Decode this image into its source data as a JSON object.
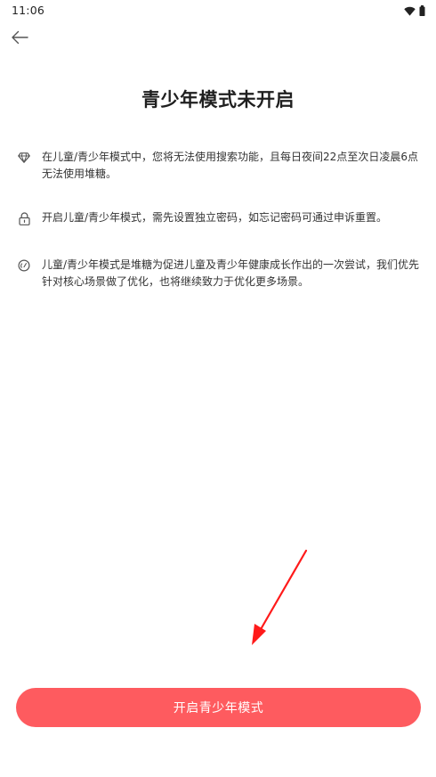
{
  "status_bar": {
    "time": "11:06",
    "icons": [
      "wifi-icon",
      "battery-icon"
    ]
  },
  "nav": {
    "back_icon": "arrow-left-icon"
  },
  "title": "青少年模式未开启",
  "info_items": [
    {
      "icon": "diamond-icon",
      "text": "在儿童/青少年模式中，您将无法使用搜索功能，且每日夜间22点至次日凌晨6点无法使用堆糖。"
    },
    {
      "icon": "lock-icon",
      "text": "开启儿童/青少年模式，需先设置独立密码，如忘记密码可通过申诉重置。"
    },
    {
      "icon": "gauge-icon",
      "text": "儿童/青少年模式是堆糖为促进儿童及青少年健康成长作出的一次尝试，我们优先针对核心场景做了优化，也将继续致力于优化更多场景。"
    }
  ],
  "primary_button": {
    "label": "开启青少年模式"
  },
  "colors": {
    "accent": "#fe5b5f",
    "annotation_arrow": "#ff1a1a",
    "text_primary": "#1f1f1f",
    "text_body": "#333333",
    "icon": "#555555"
  }
}
